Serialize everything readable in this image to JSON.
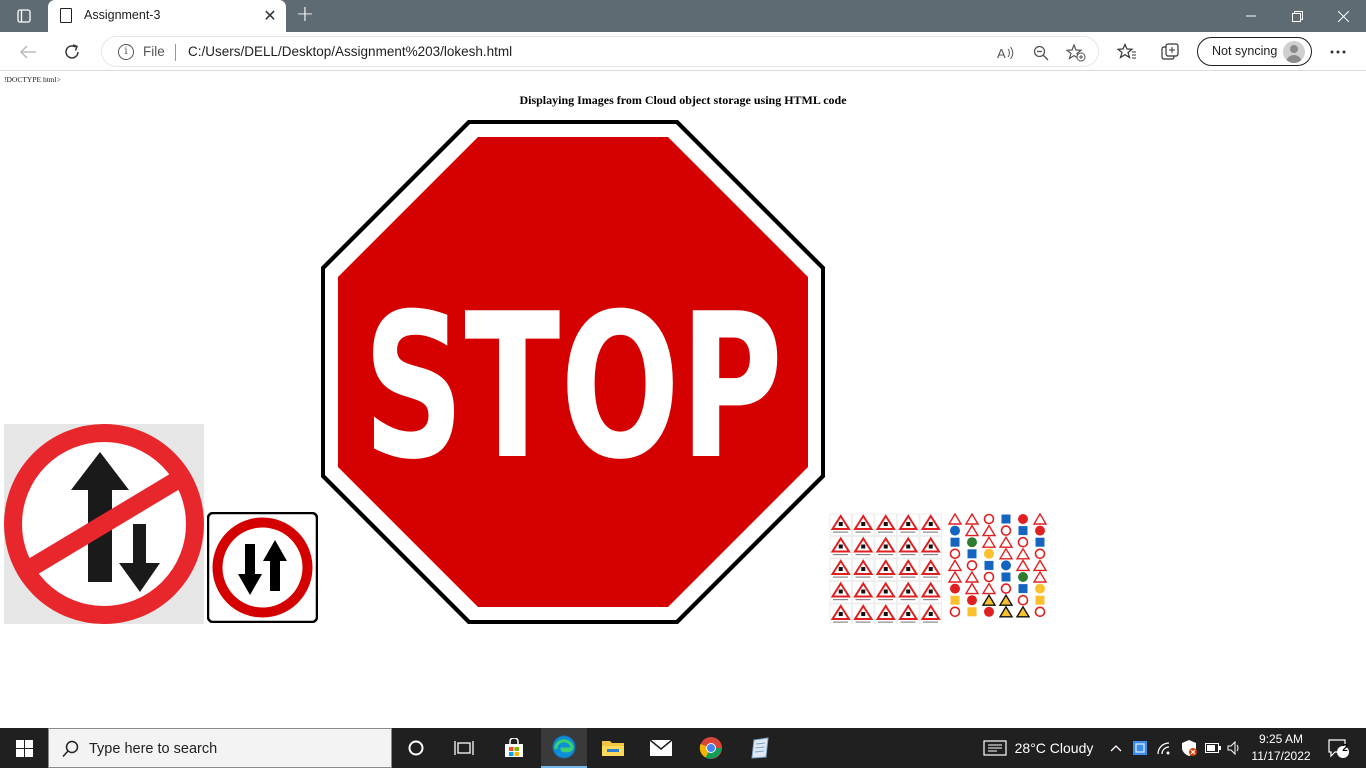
{
  "browser": {
    "tab_title": "Assignment-3",
    "address_scheme": "File",
    "address_url": "C:/Users/DELL/Desktop/Assignment%203/lokesh.html",
    "sync_label": "Not syncing"
  },
  "page": {
    "doctype_text": "!DOCTYPE html>",
    "heading": "Displaying Images from Cloud object storage using HTML code",
    "stop_sign_text": "STOP"
  },
  "taskbar": {
    "search_placeholder": "Type here to search",
    "weather": "28°C  Cloudy",
    "time": "9:25 AM",
    "date": "11/17/2022",
    "notification_count": "2"
  },
  "colors": {
    "stop_red": "#d50000",
    "no_overtake_red": "#e8272d",
    "tabstrip": "#5f6b73",
    "taskbar": "#202020"
  }
}
